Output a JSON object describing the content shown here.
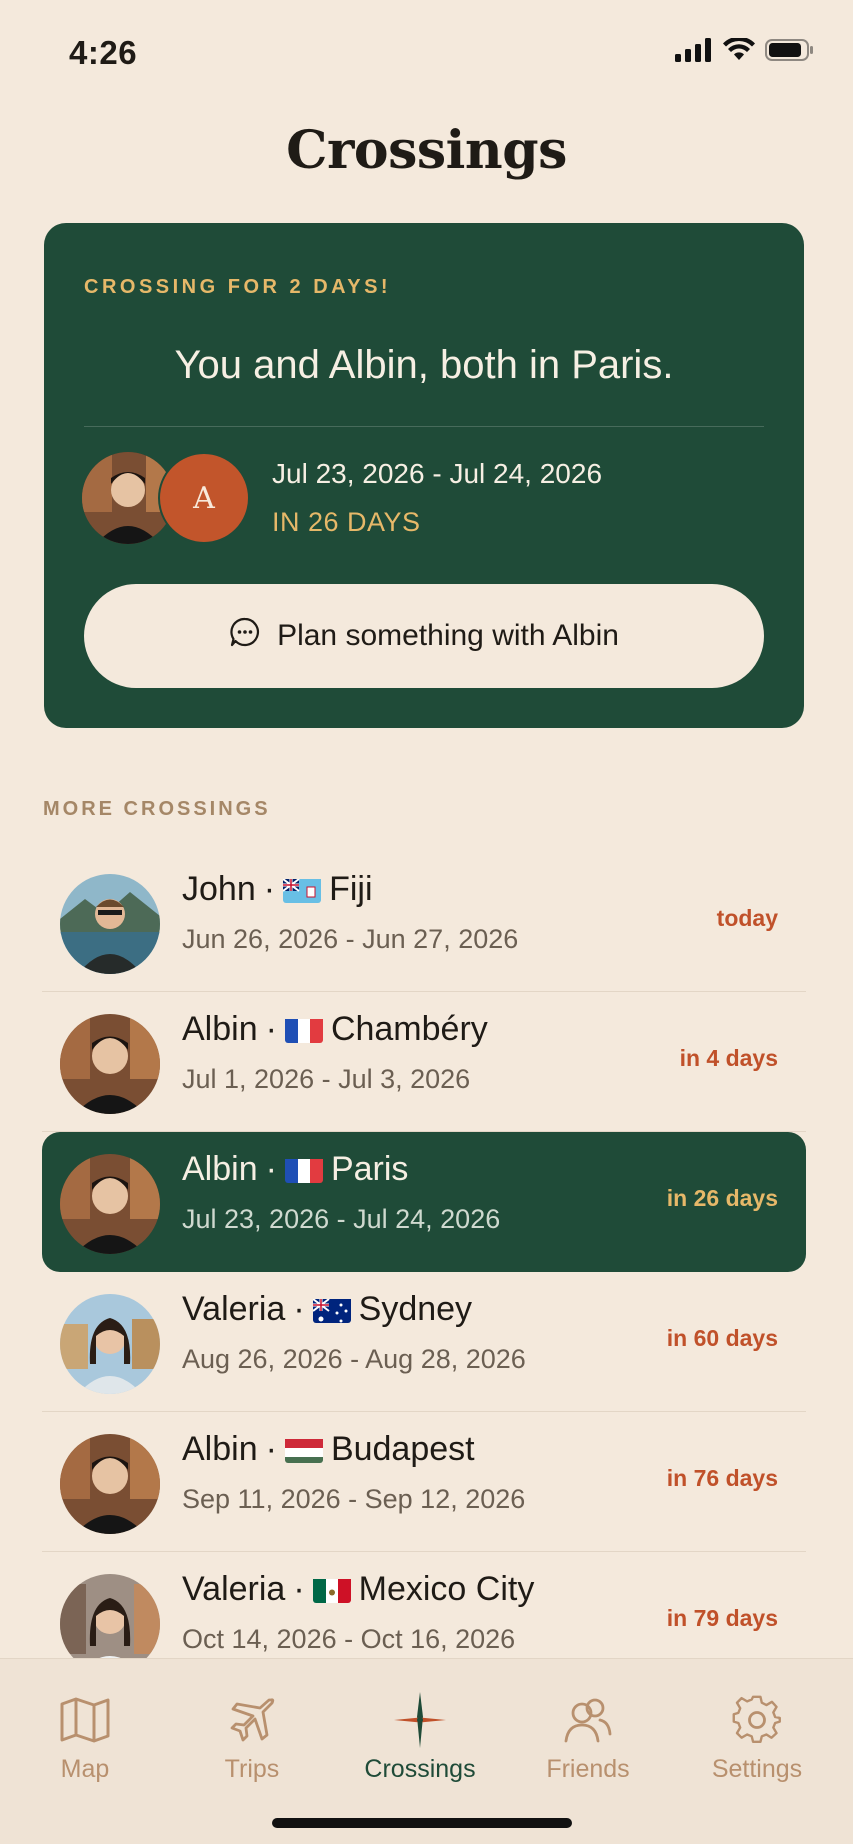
{
  "status_bar": {
    "time": "4:26"
  },
  "page": {
    "title": "Crossings"
  },
  "hero": {
    "eyebrow": "CROSSING FOR 2 DAYS!",
    "headline": "You and Albin, both in Paris.",
    "avatar_initial": "A",
    "dates": "Jul 23, 2026 - Jul 24, 2026",
    "countdown": "IN 26 DAYS",
    "button_label": "Plan something with Albin"
  },
  "more": {
    "label": "MORE CROSSINGS",
    "rows": [
      {
        "name": "John",
        "place": "Fiji",
        "dates": "Jun 26, 2026 - Jun 27, 2026",
        "when": "today"
      },
      {
        "name": "Albin",
        "place": "Chambéry",
        "dates": "Jul 1, 2026 - Jul 3, 2026",
        "when": "in 4 days"
      },
      {
        "name": "Albin",
        "place": "Paris",
        "dates": "Jul 23, 2026 - Jul 24, 2026",
        "when": "in 26 days"
      },
      {
        "name": "Valeria",
        "place": "Sydney",
        "dates": "Aug 26, 2026 - Aug 28, 2026",
        "when": "in 60 days"
      },
      {
        "name": "Albin",
        "place": "Budapest",
        "dates": "Sep 11, 2026 - Sep 12, 2026",
        "when": "in 76 days"
      },
      {
        "name": "Valeria",
        "place": "Mexico City",
        "dates": "Oct 14, 2026 - Oct 16, 2026",
        "when": "in 79 days"
      }
    ],
    "separator": "·"
  },
  "tabs": {
    "map": "Map",
    "trips": "Trips",
    "crossings": "Crossings",
    "friends": "Friends",
    "settings": "Settings"
  },
  "colors": {
    "background": "#f4e9dc",
    "card_green": "#1f4b38",
    "accent_gold": "#e6b869",
    "accent_red": "#c0512a"
  }
}
